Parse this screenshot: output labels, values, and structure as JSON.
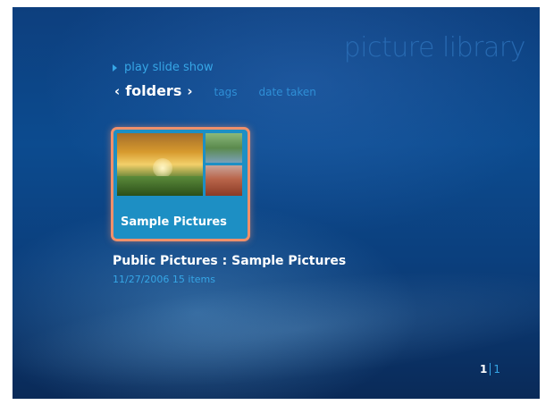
{
  "header": {
    "title": "picture library"
  },
  "actions": {
    "play_label": "play slide show"
  },
  "nav": {
    "active_tab": "folders",
    "tabs": [
      "tags",
      "date taken"
    ],
    "chevron_left": "‹",
    "chevron_right": "›"
  },
  "tile": {
    "label": "Sample Pictures"
  },
  "details": {
    "path": "Public Pictures  :  Sample Pictures",
    "meta": "11/27/2006   15 items"
  },
  "pager": {
    "current": "1",
    "total": "1"
  },
  "colors": {
    "accent": "#36a6e6",
    "tile_bg": "#1d8fc4",
    "focus_border": "#f0906a"
  }
}
